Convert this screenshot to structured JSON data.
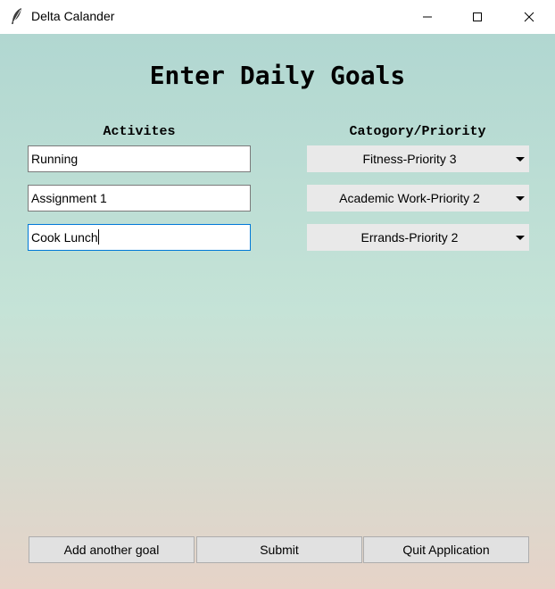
{
  "window": {
    "title": "Delta Calander",
    "icon": "feather-icon"
  },
  "heading": "Enter Daily Goals",
  "columns": {
    "activities": "Activites",
    "category": "Catogory/Priority"
  },
  "goals": [
    {
      "activity": "Running",
      "category": "Fitness-Priority 3",
      "focused": false
    },
    {
      "activity": "Assignment 1",
      "category": "Academic Work-Priority 2",
      "focused": false
    },
    {
      "activity": "Cook Lunch",
      "category": "Errands-Priority 2",
      "focused": true
    }
  ],
  "buttons": {
    "add": "Add another goal",
    "submit": "Submit",
    "quit": "Quit Application"
  },
  "colors": {
    "gradient_top": "#b1d7d1",
    "gradient_mid": "#c5e3d7",
    "gradient_bottom": "#e6d3c8",
    "focus_border": "#0078d7"
  }
}
